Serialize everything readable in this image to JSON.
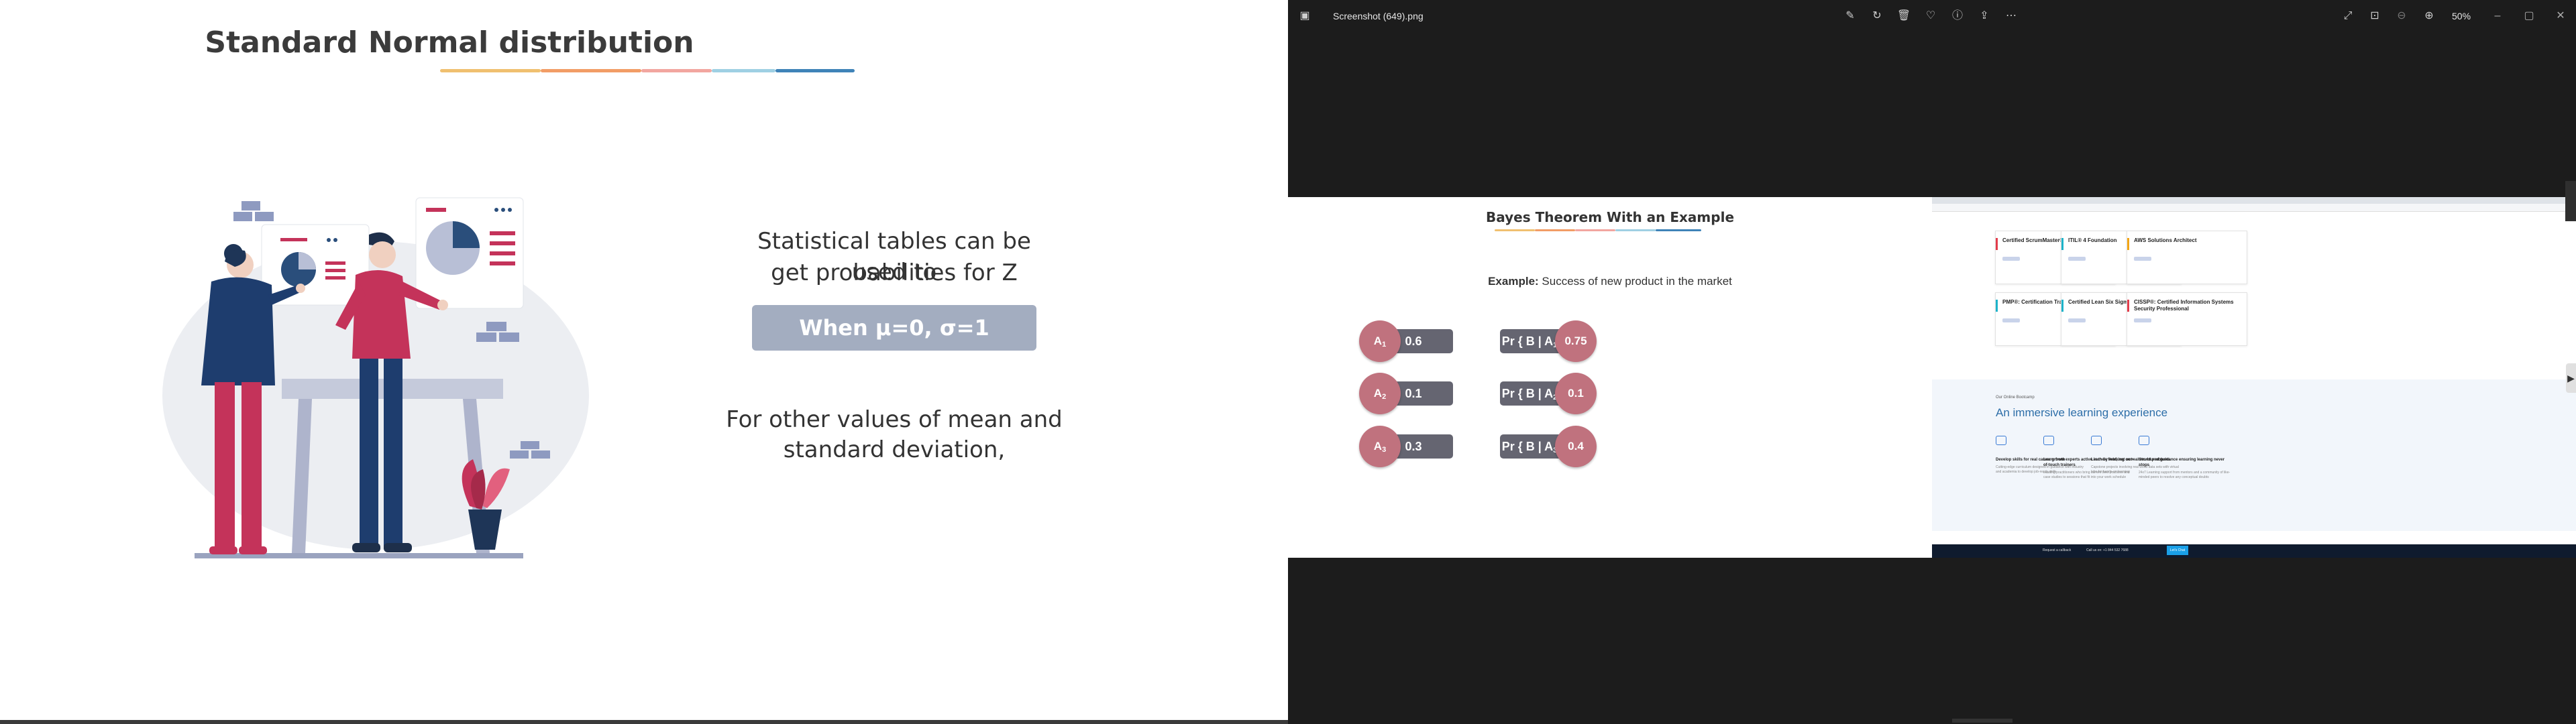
{
  "slide": {
    "title": "Standard Normal distribution",
    "line1": "Statistical tables can be used to",
    "line2": "get probabilities for Z",
    "highlight": "When μ=0, σ=1",
    "line3": "For other values of mean and",
    "line4": "standard deviation,"
  },
  "viewer": {
    "file_name": "Screenshot (649).png",
    "zoom": "50%",
    "toolbar_icons": [
      "edit-icon",
      "rotate-icon",
      "delete-icon",
      "favorite-icon",
      "info-icon",
      "share-icon",
      "more-icon"
    ],
    "right_icons": [
      "fullscreen-icon",
      "fit-icon",
      "zoom-out-icon",
      "zoom-in-icon"
    ]
  },
  "bayes": {
    "title": "Bayes Theorem With an Example",
    "example_label": "Example:",
    "example_text": "Success of new product in the market",
    "left_rows": [
      {
        "label": "A",
        "sub": "1",
        "value": "0.6"
      },
      {
        "label": "A",
        "sub": "2",
        "value": "0.1"
      },
      {
        "label": "A",
        "sub": "3",
        "value": "0.3"
      }
    ],
    "right_rows": [
      {
        "label": "Pr { B | A",
        "sub": "1",
        "close": " }",
        "value": "0.75"
      },
      {
        "label": "Pr { B | A",
        "sub": "2",
        "close": " }",
        "value": "0.1"
      },
      {
        "label": "Pr { B | A",
        "sub": "3",
        "close": " }",
        "value": "0.4"
      }
    ]
  },
  "web": {
    "cards": [
      {
        "title": "Certified ScrumMaster® (CSM)",
        "color": "#e23c4b"
      },
      {
        "title": "ITIL® 4 Foundation",
        "color": "#1db3c9"
      },
      {
        "title": "AWS Solutions Architect",
        "color": "#f2a516"
      },
      {
        "title": "PMP®: Certification Training",
        "color": "#1db3c9"
      },
      {
        "title": "Certified Lean Six Sigma Green Belt",
        "color": "#1db3c9"
      },
      {
        "title": "CISSP®: Certified Information Systems Security Professional",
        "color": "#e23c4b"
      }
    ],
    "section_kicker": "Our Online Bootcamp",
    "section_title": "An immersive learning experience",
    "features": [
      {
        "title": "Develop skills for real career growth",
        "desc": "Cutting-edge curriculum designed in guidance with industry and academia to develop job-ready skills"
      },
      {
        "title": "Learn from experts active in their field, not out-of-touch trainers",
        "desc": "Leading practitioners who bring current best practices and case studies to sessions that fit into your work schedule"
      },
      {
        "title": "Learn by working on real-world problems",
        "desc": "Capstone projects involving real world data sets with virtual labs for hands-on learning"
      },
      {
        "title": "Structured guidance ensuring learning never stops",
        "desc": "24x7 Learning support from mentors and a community of like-minded peers to resolve any conceptual doubts"
      }
    ],
    "footer": {
      "callback": "Request a callback",
      "call": "Call us on: +1 844 532 7688",
      "cta": "Let's Chat"
    }
  }
}
